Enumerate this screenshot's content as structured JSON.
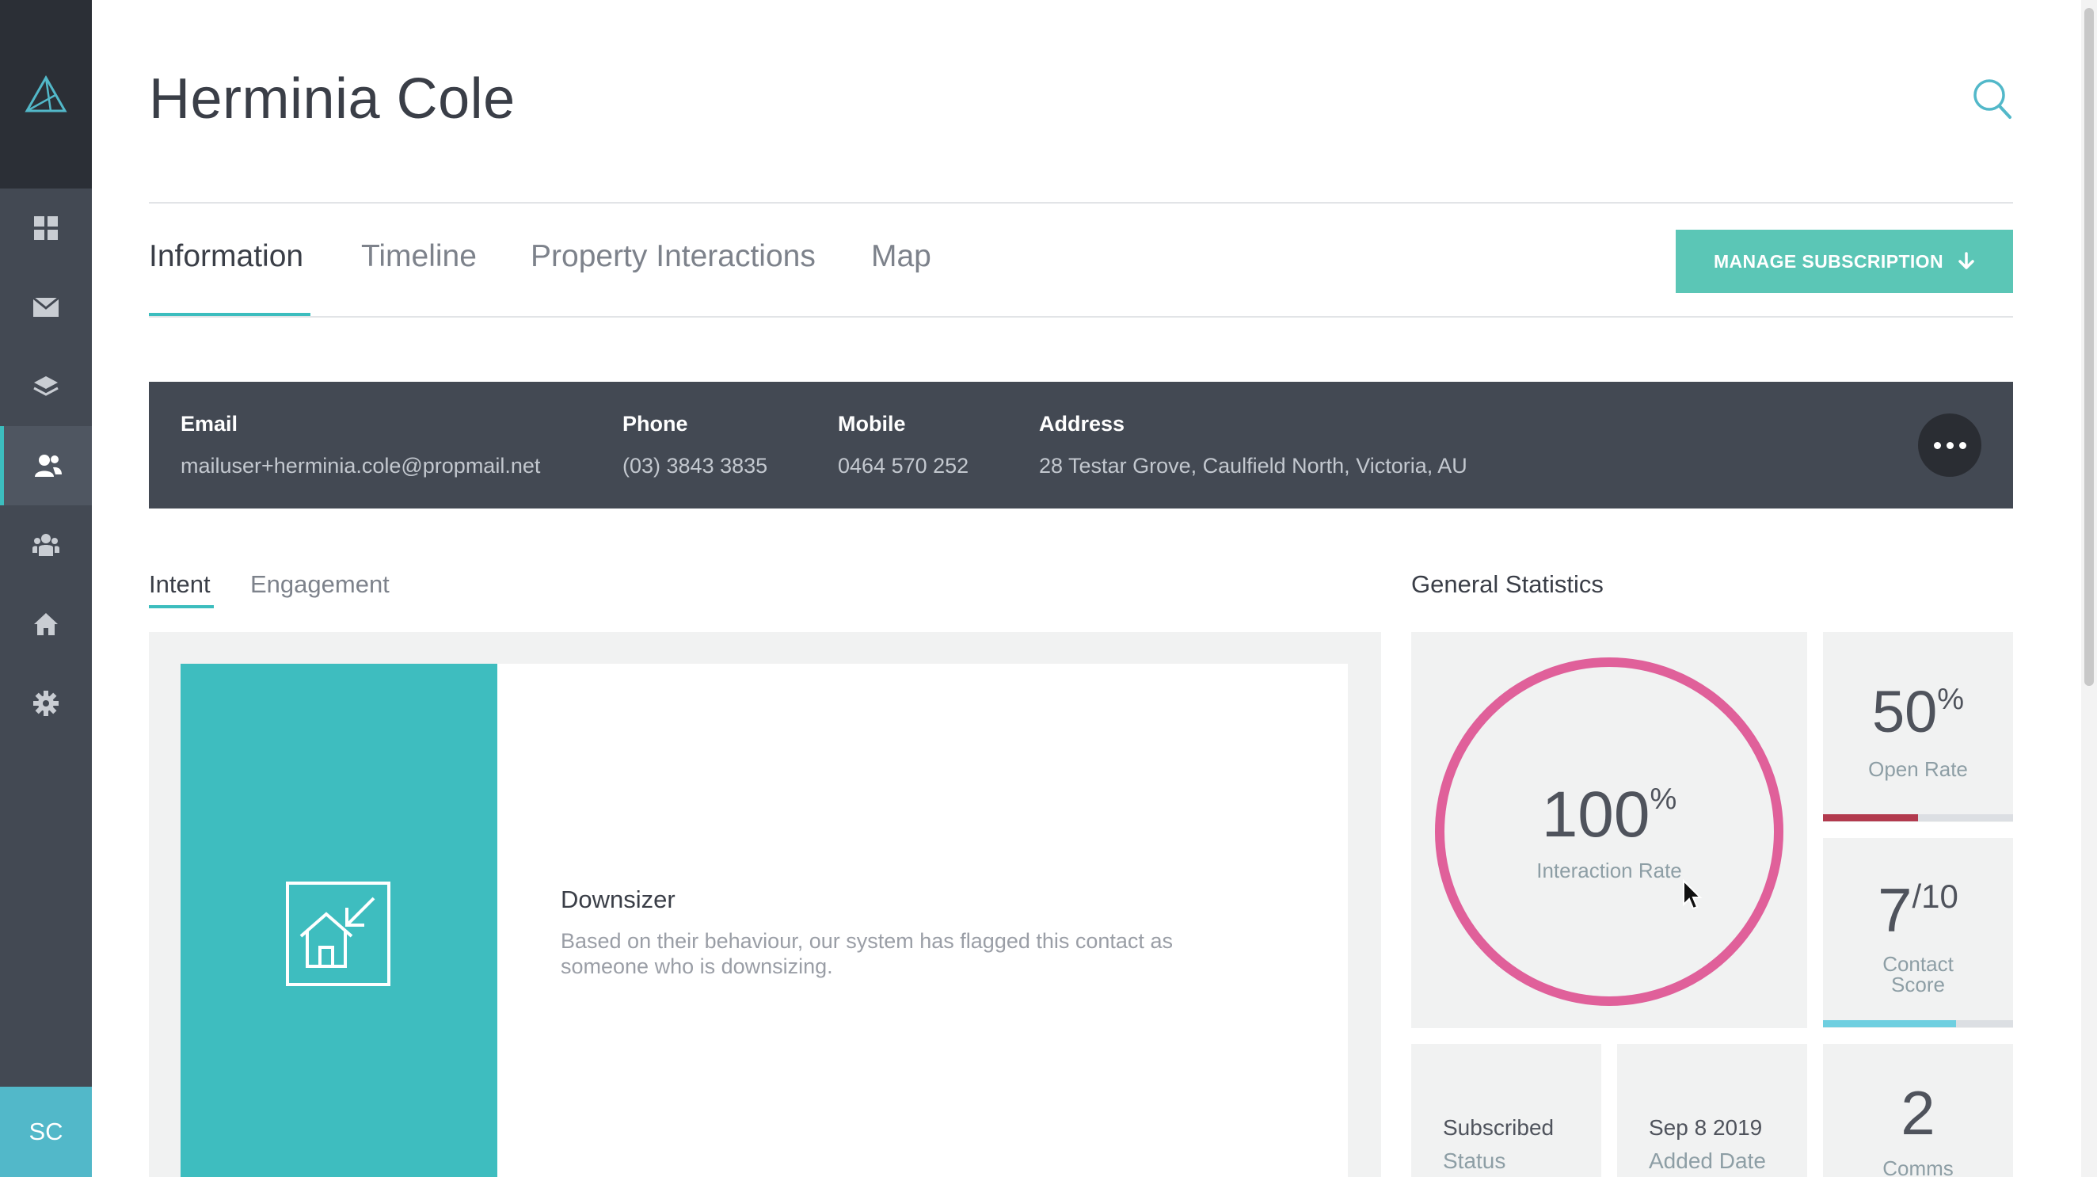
{
  "sidebar": {
    "logo": "triangle-logo",
    "items": [
      {
        "name": "dashboard",
        "icon": "grid-icon"
      },
      {
        "name": "mail",
        "icon": "envelope-icon"
      },
      {
        "name": "layers",
        "icon": "layers-icon"
      },
      {
        "name": "contacts",
        "icon": "contacts-icon",
        "active": true
      },
      {
        "name": "groups",
        "icon": "group-icon"
      },
      {
        "name": "properties",
        "icon": "home-icon"
      },
      {
        "name": "settings",
        "icon": "gear-icon"
      }
    ],
    "avatar": "SC"
  },
  "header": {
    "title": "Herminia Cole",
    "search_icon": "search-icon"
  },
  "tabs": [
    {
      "label": "Information",
      "active": true
    },
    {
      "label": "Timeline"
    },
    {
      "label": "Property Interactions"
    },
    {
      "label": "Map"
    }
  ],
  "manage_button": {
    "label": "MANAGE SUBSCRIPTION",
    "icon": "arrow-down-icon"
  },
  "contact": {
    "email": {
      "label": "Email",
      "value": "mailuser+herminia.cole@propmail.net"
    },
    "phone": {
      "label": "Phone",
      "value": "(03) 3843 3835"
    },
    "mobile": {
      "label": "Mobile",
      "value": "0464 570 252"
    },
    "address": {
      "label": "Address",
      "value": "28 Testar Grove, Caulfield North, Victoria, AU"
    }
  },
  "subtabs": [
    {
      "label": "Intent",
      "active": true
    },
    {
      "label": "Engagement"
    }
  ],
  "intent": {
    "title": "Downsizer",
    "description": "Based on their behaviour, our system has flagged this contact as someone who is downsizing.",
    "icon": "downsize-home-icon",
    "tile_color": "#3ebdbf"
  },
  "stats": {
    "title": "General Statistics",
    "interaction_rate": {
      "value": "100",
      "unit": "%",
      "label": "Interaction Rate",
      "fraction": 1.0,
      "color": "#e0609a"
    },
    "open_rate": {
      "value": "50",
      "unit": "%",
      "label": "Open Rate",
      "fraction": 0.5,
      "color": "#b23a4e"
    },
    "contact_score": {
      "value": "7",
      "max": "/10",
      "label": "Contact Score",
      "fraction": 0.7,
      "color": "#6fcfe0"
    },
    "subscribed": {
      "value": "Subscribed",
      "label": "Status"
    },
    "added_date": {
      "value": "Sep 8 2019",
      "label": "Added Date"
    },
    "comms": {
      "value": "2",
      "label": "Comms"
    }
  }
}
